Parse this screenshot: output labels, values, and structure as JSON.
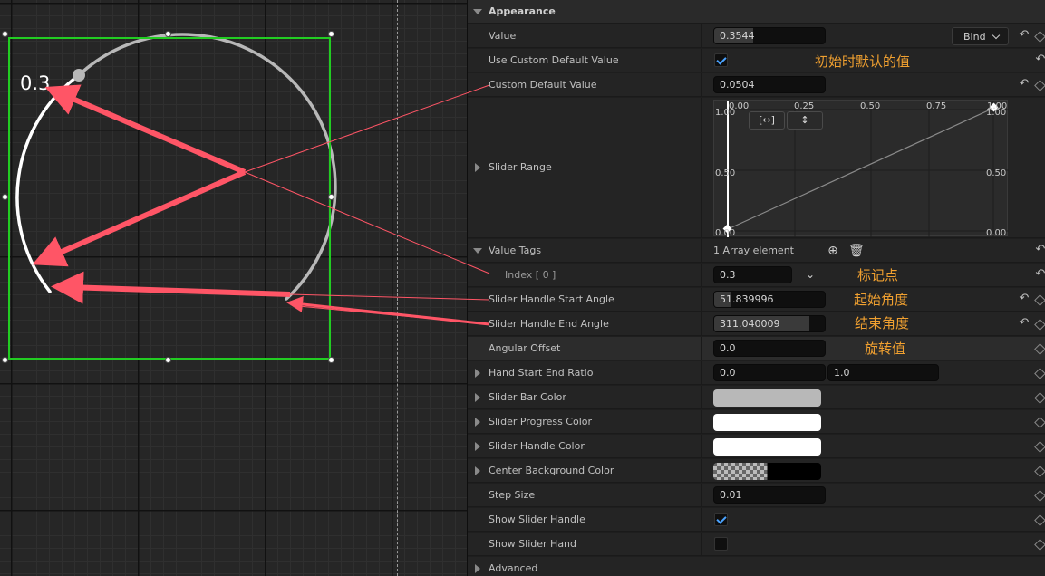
{
  "canvas": {
    "widget_value_label": "0.3"
  },
  "details": {
    "section_title": "Appearance",
    "value": {
      "label": "Value",
      "text": "0.3544",
      "progress": 0.3544,
      "bind_label": "Bind"
    },
    "use_custom_default": {
      "label": "Use Custom Default Value",
      "checked": true
    },
    "custom_default": {
      "label": "Custom Default Value",
      "text": "0.0504"
    },
    "slider_range": {
      "label": "Slider Range",
      "top_axis": [
        "0.00",
        "0.25",
        "0.50",
        "0.75",
        "1.00"
      ],
      "left_axis": [
        "1.00",
        "0.50",
        "0.00"
      ],
      "right_axis": [
        "1.00",
        "0.50",
        "0.00"
      ],
      "fit_horizontal_icon": "fit-horizontal-icon",
      "fit_vertical_icon": "fit-vertical-icon"
    },
    "value_tags": {
      "label": "Value Tags",
      "summary": "1 Array element"
    },
    "index0": {
      "label": "Index [ 0 ]",
      "text": "0.3"
    },
    "start_angle": {
      "label": "Slider Handle Start Angle",
      "text": "51.839996",
      "progress": 0.144
    },
    "end_angle": {
      "label": "Slider Handle End Angle",
      "text": "311.040009",
      "progress": 0.864
    },
    "angular_offset": {
      "label": "Angular Offset",
      "text": "0.0"
    },
    "hand_ratio": {
      "label": "Hand Start End Ratio",
      "a": "0.0",
      "b": "1.0"
    },
    "bar_color": {
      "label": "Slider Bar Color",
      "color": "#b8b8b8"
    },
    "progress_color": {
      "label": "Slider Progress Color",
      "color": "#ffffff"
    },
    "handle_color": {
      "label": "Slider Handle Color",
      "color": "#ffffff"
    },
    "center_bg_color": {
      "label": "Center Background Color",
      "color": "#000000"
    },
    "step_size": {
      "label": "Step Size",
      "text": "0.01"
    },
    "show_handle": {
      "label": "Show Slider Handle",
      "checked": true
    },
    "show_hand": {
      "label": "Show Slider Hand",
      "checked": false
    },
    "advanced": {
      "label": "Advanced"
    }
  },
  "annotations": {
    "initial_default": "初始时默认的值",
    "marker_point": "标记点",
    "start_angle": "起始角度",
    "end_angle": "结束角度",
    "rotation": "旋转值"
  },
  "colors": {
    "selection": "#22cc22",
    "annotation_arrow": "#ff5566",
    "annotation_text": "#f0a030",
    "checkbox_accent": "#4aa3ff"
  }
}
